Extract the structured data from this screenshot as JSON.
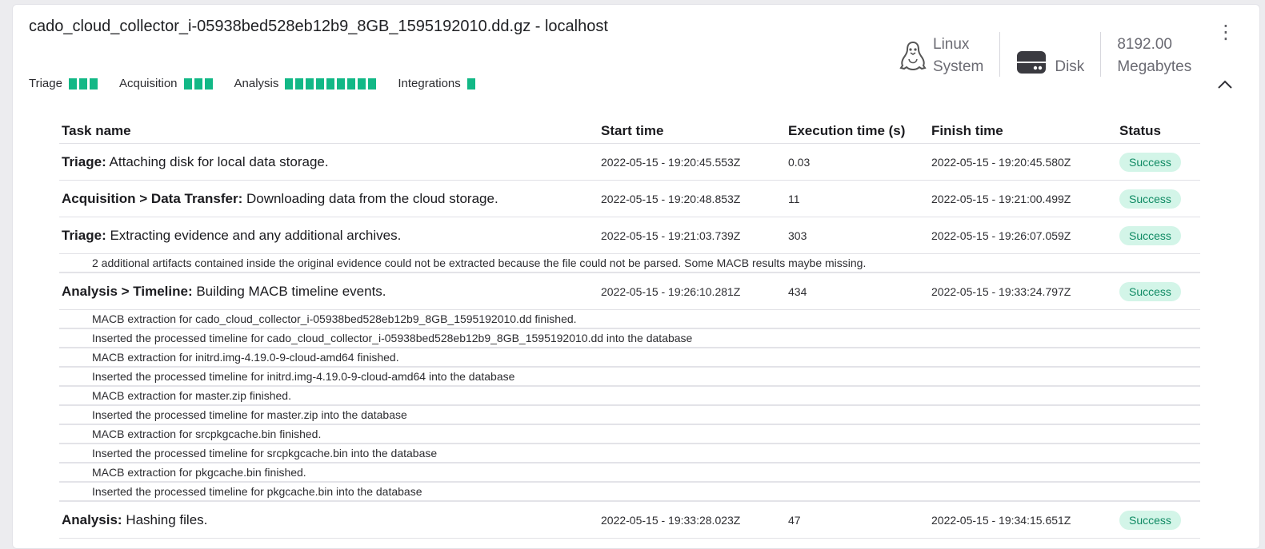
{
  "header": {
    "title": "cado_cloud_collector_i-05938bed528eb12b9_8GB_1595192010.dd.gz - localhost",
    "tags": [
      {
        "label": "Triage",
        "blocks": 3
      },
      {
        "label": "Acquisition",
        "blocks": 3
      },
      {
        "label": "Analysis",
        "blocks": 9
      },
      {
        "label": "Integrations",
        "blocks": 1
      }
    ],
    "accent_color": "#12b886"
  },
  "stats": {
    "system": {
      "value": "Linux",
      "label": "System",
      "icon": "linux-penguin-icon"
    },
    "disk": {
      "label": "Disk",
      "icon": "disk-icon"
    },
    "size": {
      "value": "8192.00",
      "label": "Megabytes"
    }
  },
  "table": {
    "columns": [
      "Task name",
      "Start time",
      "Execution time (s)",
      "Finish time",
      "Status"
    ],
    "rows": [
      {
        "prefix": "Triage:",
        "desc": " Attaching disk for local data storage.",
        "start": "2022-05-15 - 19:20:45.553Z",
        "exec": "0.03",
        "finish": "2022-05-15 - 19:20:45.580Z",
        "status": "Success",
        "details": []
      },
      {
        "prefix": "Acquisition > Data Transfer:",
        "desc": " Downloading data from the cloud storage.",
        "start": "2022-05-15 - 19:20:48.853Z",
        "exec": "11",
        "finish": "2022-05-15 - 19:21:00.499Z",
        "status": "Success",
        "details": []
      },
      {
        "prefix": "Triage:",
        "desc": " Extracting evidence and any additional archives.",
        "start": "2022-05-15 - 19:21:03.739Z",
        "exec": "303",
        "finish": "2022-05-15 - 19:26:07.059Z",
        "status": "Success",
        "details": [
          "2 additional artifacts contained inside the original evidence could not be extracted because the file could not be parsed. Some MACB results maybe missing."
        ]
      },
      {
        "prefix": "Analysis > Timeline:",
        "desc": " Building MACB timeline events.",
        "start": "2022-05-15 - 19:26:10.281Z",
        "exec": "434",
        "finish": "2022-05-15 - 19:33:24.797Z",
        "status": "Success",
        "details": [
          "MACB extraction for cado_cloud_collector_i-05938bed528eb12b9_8GB_1595192010.dd finished.",
          "Inserted the processed timeline for cado_cloud_collector_i-05938bed528eb12b9_8GB_1595192010.dd into the database",
          "MACB extraction for initrd.img-4.19.0-9-cloud-amd64 finished.",
          "Inserted the processed timeline for initrd.img-4.19.0-9-cloud-amd64 into the database",
          "MACB extraction for master.zip finished.",
          "Inserted the processed timeline for master.zip into the database",
          "MACB extraction for srcpkgcache.bin finished.",
          "Inserted the processed timeline for srcpkgcache.bin into the database",
          "MACB extraction for pkgcache.bin finished.",
          "Inserted the processed timeline for pkgcache.bin into the database"
        ]
      },
      {
        "prefix": "Analysis:",
        "desc": " Hashing files.",
        "start": "2022-05-15 - 19:33:28.023Z",
        "exec": "47",
        "finish": "2022-05-15 - 19:34:15.651Z",
        "status": "Success",
        "details": []
      }
    ]
  }
}
